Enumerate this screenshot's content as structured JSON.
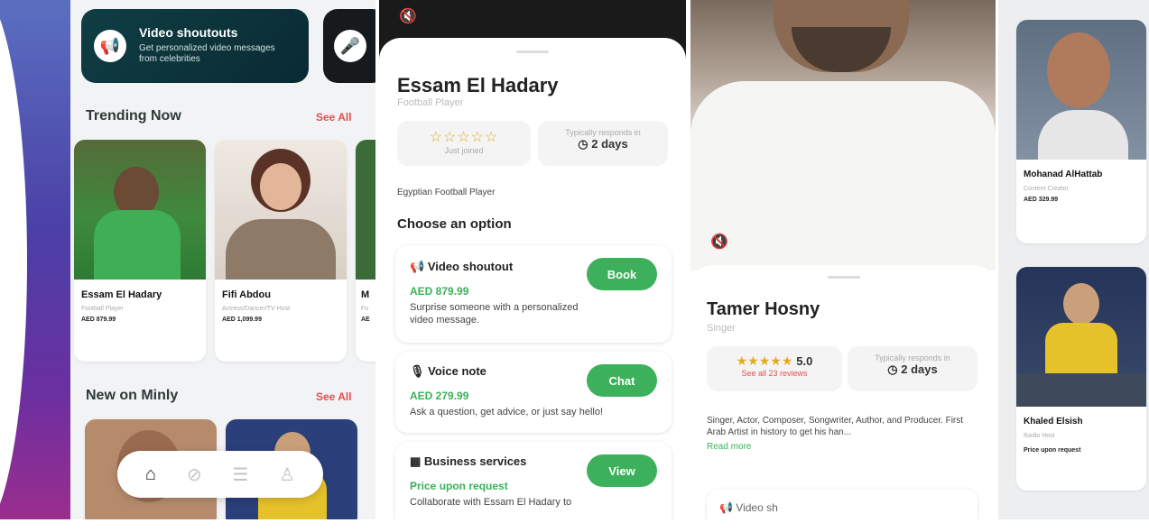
{
  "screen1": {
    "promo": {
      "title": "Video shoutouts",
      "subtitle": "Get personalized video messages from celebrities"
    },
    "trending": {
      "title": "Trending Now",
      "see_all": "See All",
      "cards": [
        {
          "name": "Essam El Hadary",
          "role": "Football Player",
          "price": "AED 879.99"
        },
        {
          "name": "Fifi Abdou",
          "role": "Actress/Dancer/TV Host",
          "price": "AED 1,099.99"
        },
        {
          "name": "M",
          "role": "Fo",
          "price": "AE"
        }
      ]
    },
    "new_on": {
      "title": "New on Minly",
      "see_all": "See All"
    },
    "nav": [
      "home-icon",
      "compass-icon",
      "list-icon",
      "profile-icon"
    ]
  },
  "screen2": {
    "name": "Essam El Hadary",
    "role": "Football Player",
    "rating": {
      "stars": "☆☆☆☆☆",
      "label": "Just joined"
    },
    "response": {
      "label": "Typically responds in",
      "value": "2 days"
    },
    "bio": "Egyptian Football Player",
    "choose_title": "Choose an option",
    "options": [
      {
        "icon": "megaphone-icon",
        "title": "Video shoutout",
        "price": "AED 879.99",
        "desc": "Surprise someone with a personalized video message.",
        "button": "Book"
      },
      {
        "icon": "mic-icon",
        "title": "Voice note",
        "price": "AED 279.99",
        "desc": "Ask a question, get advice, or just say hello!",
        "button": "Chat"
      },
      {
        "icon": "building-icon",
        "title": "Business services",
        "price": "Price upon request",
        "desc": "Collaborate with Essam El Hadary to",
        "button": "View"
      }
    ]
  },
  "screen3": {
    "name": "Tamer Hosny",
    "role": "Singer",
    "rating": {
      "stars": "★★★★★",
      "score": "5.0",
      "reviews": "See all 23 reviews"
    },
    "response": {
      "label": "Typically responds in",
      "value": "2 days"
    },
    "bio": "Singer, Actor, Composer, Songwriter, Author, and Producer. First Arab Artist in history to get his han...",
    "read_more": "Read more",
    "option_peek": "Video sh"
  },
  "screen4": {
    "cards": [
      {
        "name": "Mohanad AlHattab",
        "role": "Content Creator",
        "price": "AED 329.99"
      },
      {
        "name": "Khaled Elsish",
        "role": "Radio Host",
        "price": "Price upon request"
      }
    ]
  },
  "colors": {
    "accent_green": "#3cb05a",
    "see_all_red": "#e05050",
    "promo_bg": "#0f3e44"
  }
}
